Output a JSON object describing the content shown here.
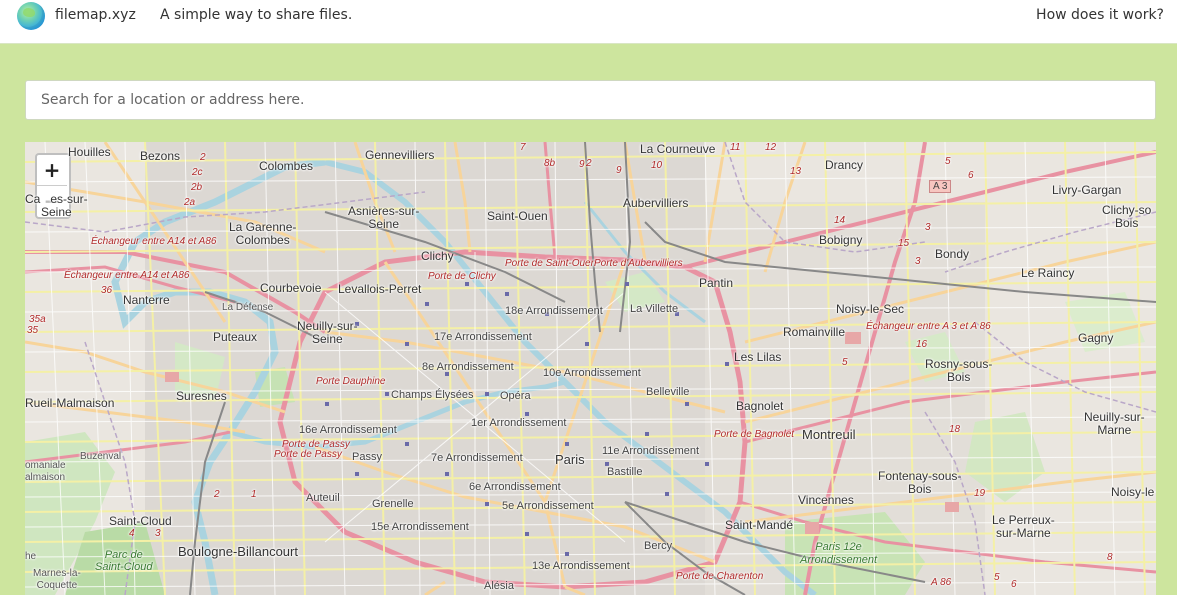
{
  "header": {
    "brand": "filemap.xyz",
    "tagline": "A simple way to share files.",
    "help_link": "How does it work?"
  },
  "search": {
    "placeholder": "Search for a location or address here."
  },
  "map": {
    "zoom_in": "+",
    "zoom_out": "−",
    "shield": "A 3",
    "labels": {
      "houilles": "Houilles",
      "bezons": "Bezons",
      "colombes": "Colombes",
      "gennevilliers": "Gennevilliers",
      "la_courneuve": "La Courneuve",
      "drancy": "Drancy",
      "livry_gargan": "Livry-Gargan",
      "clichy_sous_bois": "Clichy-so\nBois",
      "carrieres": "Ca   es-sur-\nSeine",
      "asnieres": "Asnières-sur-\nSeine",
      "saint_ouen": "Saint-Ouen",
      "aubervilliers": "Aubervilliers",
      "bobigny": "Bobigny",
      "bondy": "Bondy",
      "le_raincy": "Le Raincy",
      "la_garenne": "La Garenne-\nColombes",
      "clichy": "Clichy",
      "nanterre": "Nanterre",
      "courbevoie": "Courbevoie",
      "levallois": "Levallois-Perret",
      "pantin": "Pantin",
      "la_defense": "La Défense",
      "arr18": "18e Arrondissement",
      "la_villette": "La Villette",
      "noisy_le_sec": "Noisy-le-Sec",
      "puteaux": "Puteaux",
      "neuilly": "Neuilly-sur-\nSeine",
      "arr17": "17e Arrondissement",
      "romainville": "Romainville",
      "gagny": "Gagny",
      "les_lilas": "Les Lilas",
      "arr8": "8e Arrondissement",
      "arr10": "10e Arrondissement",
      "rosny": "Rosny-sous-\nBois",
      "rueil": "Rueil-Malmaison",
      "suresnes": "Suresnes",
      "champs": "Champs Élysées",
      "opera": "Opéra",
      "belleville": "Belleville",
      "bagnolet": "Bagnolet",
      "neuilly_marne": "Neuilly-sur-\nMarne",
      "arr16": "16e Arrondissement",
      "arr1": "1er Arrondissement",
      "montreuil": "Montreuil",
      "buzenval": "Buzenval",
      "passy": "Passy",
      "arr7": "7e Arrondissement",
      "paris": "Paris",
      "arr11": "11e Arrondissement",
      "bastille": "Bastille",
      "fontenay": "Fontenay-sous-\nBois",
      "malmaison": "omaniale\nalmaison",
      "arr6": "6e Arrondissement",
      "noisy_le_grand": "Noisy-le",
      "auteuil": "Auteuil",
      "grenelle": "Grenelle",
      "arr5": "5e Arrondissement",
      "vincennes": "Vincennes",
      "saint_cloud": "Saint-Cloud",
      "arr15": "15e Arrondissement",
      "saint_mande": "Saint-Mandé",
      "le_perreux": "Le Perreux-\nsur-Marne",
      "he": "he",
      "boulogne": "Boulogne-Billancourt",
      "bercy": "Bercy",
      "arr12": "Paris 12e\nArrondissement",
      "marnes": "Marnes-la-\nCoquette",
      "arr13": "13e Arrondissement",
      "alesia": "Alésia",
      "parc_st_cloud": "Parc de\nSaint-Cloud",
      "ech_a14_1": "Échangeur entre A14 et A86",
      "ech_a14_2": "Échangeur entre A14 et A86",
      "porte_clichy": "Porte de Clichy",
      "porte_st_ouen": "Porte de Saint-Ouen",
      "porte_aubervilliers": "Porte d'Aubervilliers",
      "ech_a3": "Échangeur entre A 3 et A 86",
      "porte_dauphine": "Porte Dauphine",
      "porte_bagnolet": "Porte de Bagnolet",
      "porte_passy": "Porte de Passy",
      "porte_passy2": "Porte de Passy",
      "porte_charenton": "Porte de Charenton",
      "a86": "A 86"
    },
    "road_numbers": [
      "7",
      "8b",
      "9",
      "2",
      "9",
      "10",
      "11",
      "12",
      "2",
      "2c",
      "2b",
      "2a",
      "13",
      "14",
      "15",
      "3",
      "3",
      "5",
      "6",
      "36",
      "35a",
      "35",
      "16",
      "18",
      "19",
      "2",
      "1",
      "4",
      "3",
      "5",
      "6",
      "8",
      "5"
    ]
  }
}
